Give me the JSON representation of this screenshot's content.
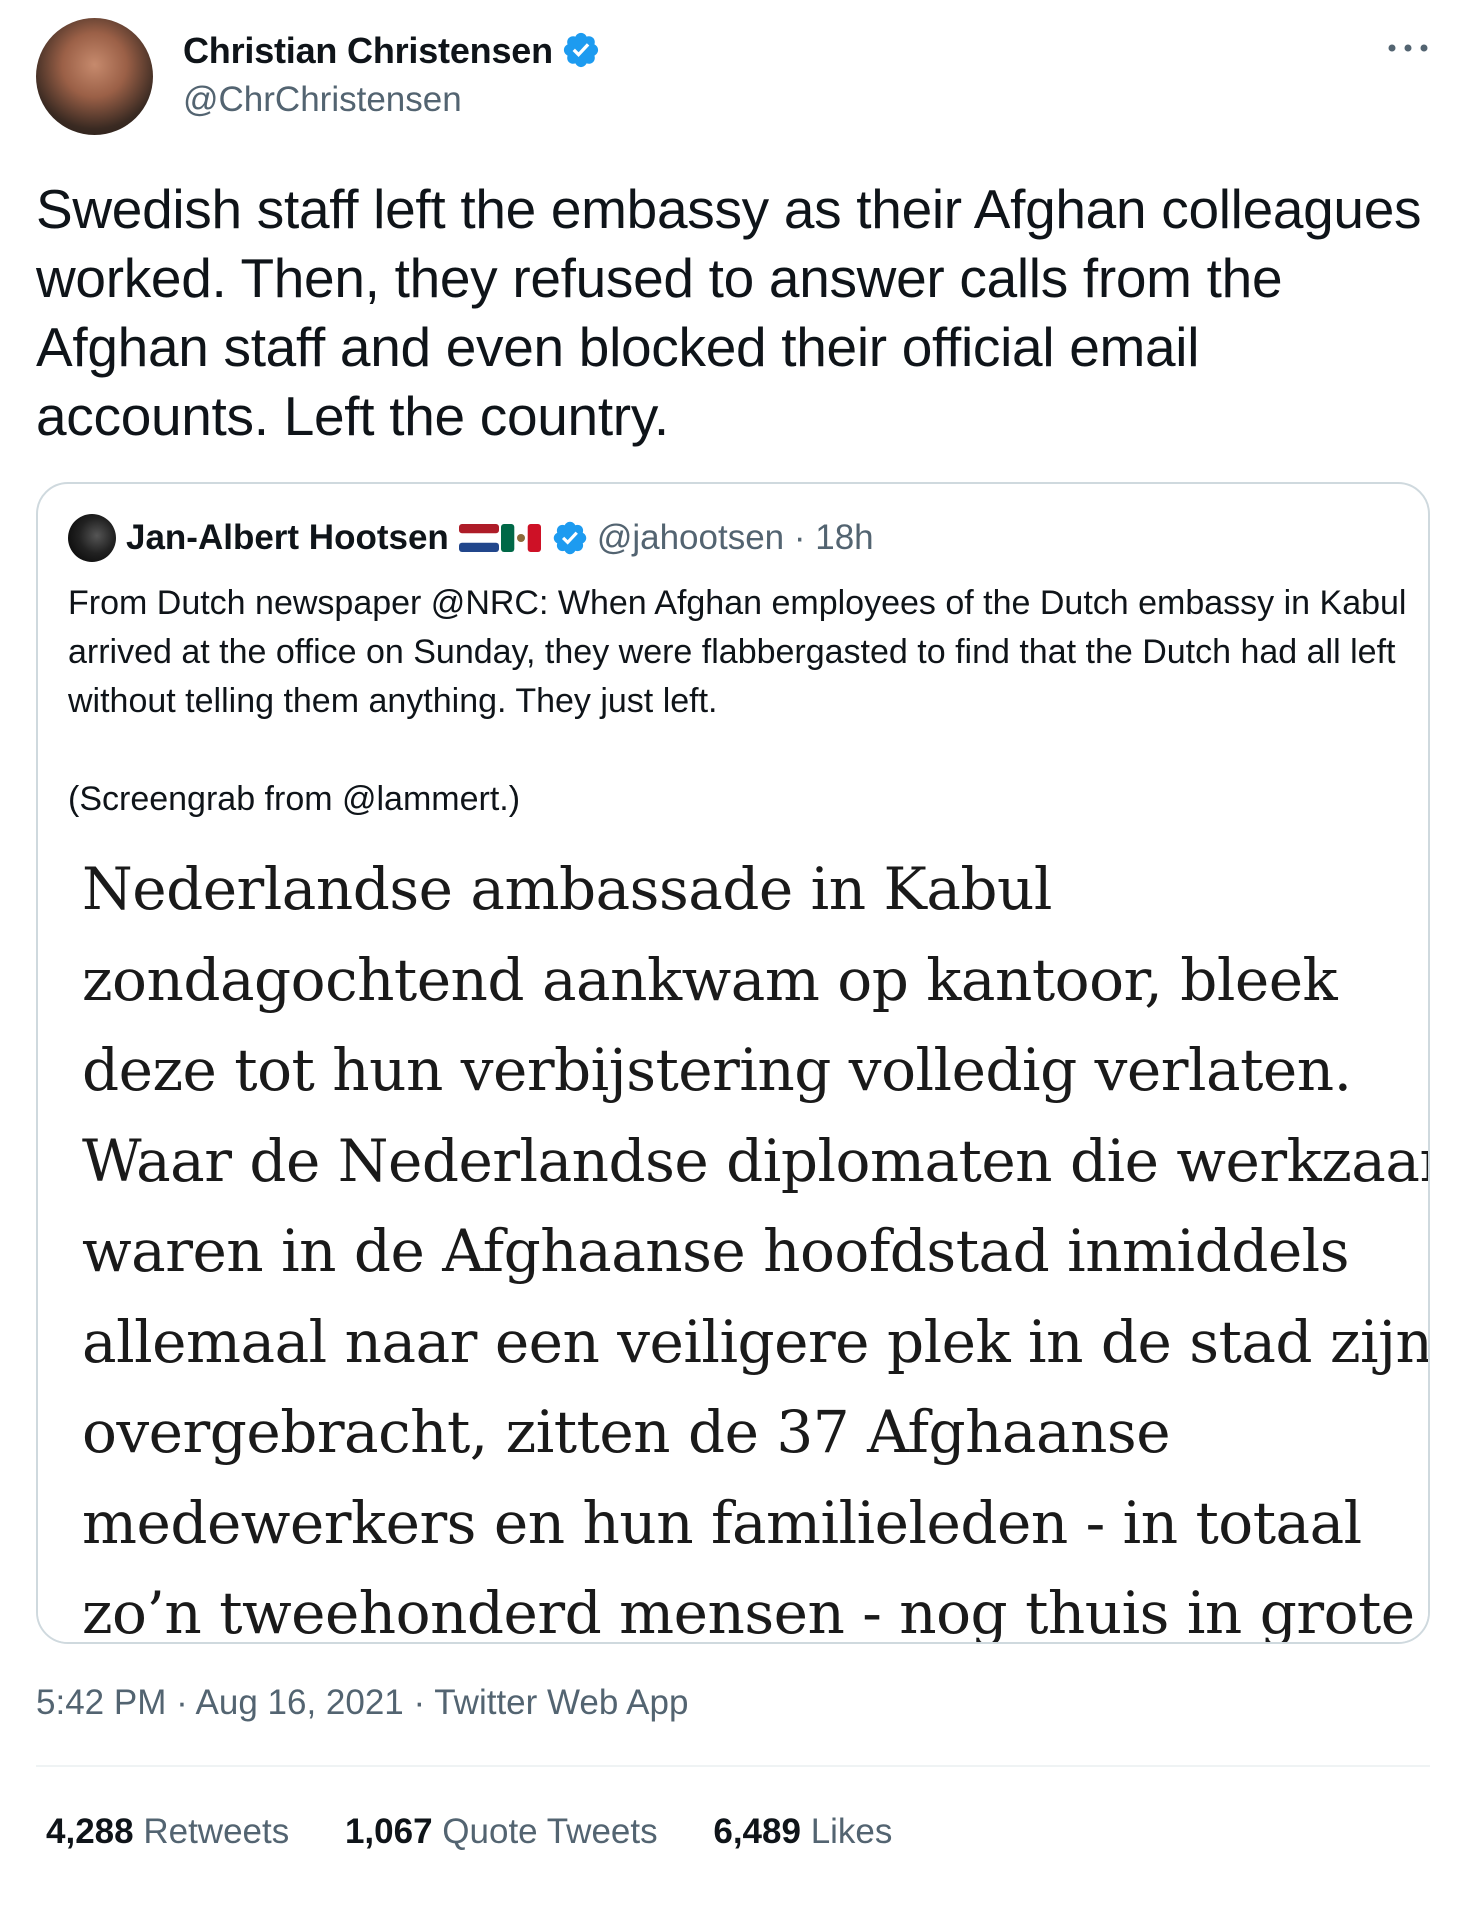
{
  "author": {
    "name": "Christian Christensen",
    "handle": "@ChrChristensen"
  },
  "tweet": {
    "text": "Swedish staff left the embassy as their Afghan colleagues worked. Then, they refused to answer calls from the Afghan staff and even blocked their official email accounts. Left the country."
  },
  "quote": {
    "name": "Jan-Albert Hootsen",
    "handle_time": "@jahootsen · 18h",
    "text": "From Dutch newspaper @NRC: When Afghan employees of the Dutch embassy in Kabul arrived at the office on Sunday, they were flabbergasted to find that the Dutch had all left without telling them anything. They just left.",
    "text2": "(Screengrab from @lammert.)",
    "news_lines": [
      "Nederlandse ambassade in Kabul",
      "zondagochtend aankwam op kantoor, bleek",
      "deze tot hun verbijstering volledig verlaten.",
      "Waar de Nederlandse diplomaten die werkzaam",
      "waren in de Afghaanse hoofdstad inmiddels",
      "allemaal naar een veiligere plek in de stad zijn",
      "overgebracht, zitten de 37 Afghaanse",
      "medewerkers en hun familieleden - in totaal",
      "zo’n tweehonderd mensen - nog thuis in grote"
    ]
  },
  "meta": {
    "timestamp": "5:42 PM · Aug 16, 2021 · Twitter Web App"
  },
  "stats": {
    "retweets": "4,288",
    "retweets_label": "Retweets",
    "quotes": "1,067",
    "quotes_label": "Quote Tweets",
    "likes": "6,489",
    "likes_label": "Likes"
  },
  "colors": {
    "verified": "#1d9bf0",
    "text": "#0f1419",
    "secondary": "#536471",
    "border": "#cfd9de"
  },
  "icons": [
    "verified-badge-icon",
    "more-options-icon",
    "netherlands-flag-icon",
    "mexico-flag-icon"
  ]
}
